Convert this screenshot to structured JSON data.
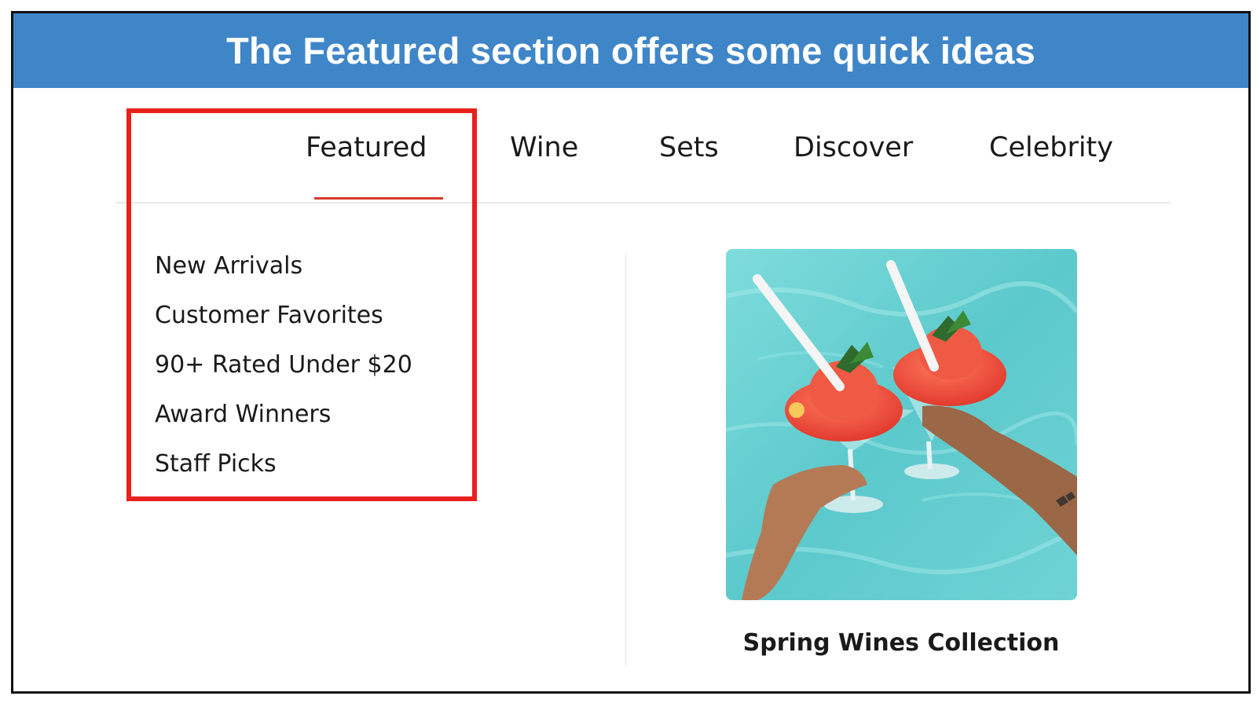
{
  "banner": {
    "title": "The Featured section offers some quick ideas"
  },
  "tabs": [
    {
      "label": "Featured",
      "active": true
    },
    {
      "label": "Wine"
    },
    {
      "label": "Sets"
    },
    {
      "label": "Discover"
    },
    {
      "label": "Celebrity"
    }
  ],
  "featured_menu": {
    "items": [
      {
        "label": "New Arrivals"
      },
      {
        "label": "Customer Favorites"
      },
      {
        "label": "90+ Rated Under $20"
      },
      {
        "label": "Award Winners"
      },
      {
        "label": "Staff Picks"
      }
    ]
  },
  "promo": {
    "caption": "Spring Wines Collection",
    "image_icon": "cocktail-photo-icon"
  },
  "colors": {
    "banner": "#3f86c8",
    "highlight": "#e8211b",
    "active_underline": "#d23b2b",
    "pool": "#6fd3d5",
    "drink": "#ee4a3a"
  }
}
